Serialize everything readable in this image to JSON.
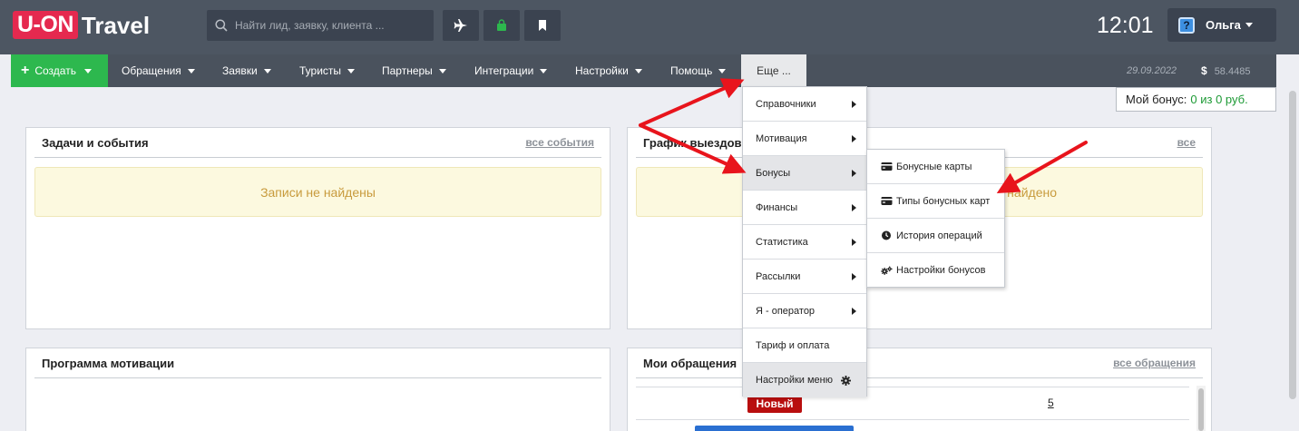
{
  "header": {
    "logo_badge": "U-ON",
    "logo_text": "Travel",
    "search_placeholder": "Найти лид, заявку, клиента ...",
    "clock": "12:01",
    "help_glyph": "?",
    "user_name": "Ольга"
  },
  "nav": {
    "create_plus": "+",
    "create_label": "Создать",
    "items": [
      "Обращения",
      "Заявки",
      "Туристы",
      "Партнеры",
      "Интеграции",
      "Настройки",
      "Помощь"
    ],
    "more_label": "Еще ...",
    "date": "29.09.2022",
    "currency_symbol": "$",
    "rate": "58.4485"
  },
  "bonus": {
    "label": "Мой бонус:",
    "value": "0 из 0 руб."
  },
  "panels": {
    "tasks_title": "Задачи и события",
    "tasks_link": "все события",
    "tasks_empty": "Записи не найдены",
    "schedule_title": "График выездов",
    "schedule_link": "все",
    "schedule_empty": "Записи не найдено",
    "motivation_title": "Программа мотивации",
    "requests_title": "Мои обращения",
    "requests_link": "все обращения",
    "new_badge": "Новый",
    "new_count": "5"
  },
  "dropdown": {
    "items": [
      "Справочники",
      "Мотивация",
      "Бонусы",
      "Финансы",
      "Статистика",
      "Рассылки",
      "Я - оператор",
      "Тариф и оплата",
      "Настройки меню"
    ]
  },
  "submenu": {
    "items": [
      "Бонусные карты",
      "Типы бонусных карт",
      "История операций",
      "Настройки бонусов"
    ]
  },
  "colors": {
    "brand": "#e5294f",
    "create": "#2db84e",
    "arrow": "#e8141c",
    "badge_new": "#b90e0e"
  }
}
